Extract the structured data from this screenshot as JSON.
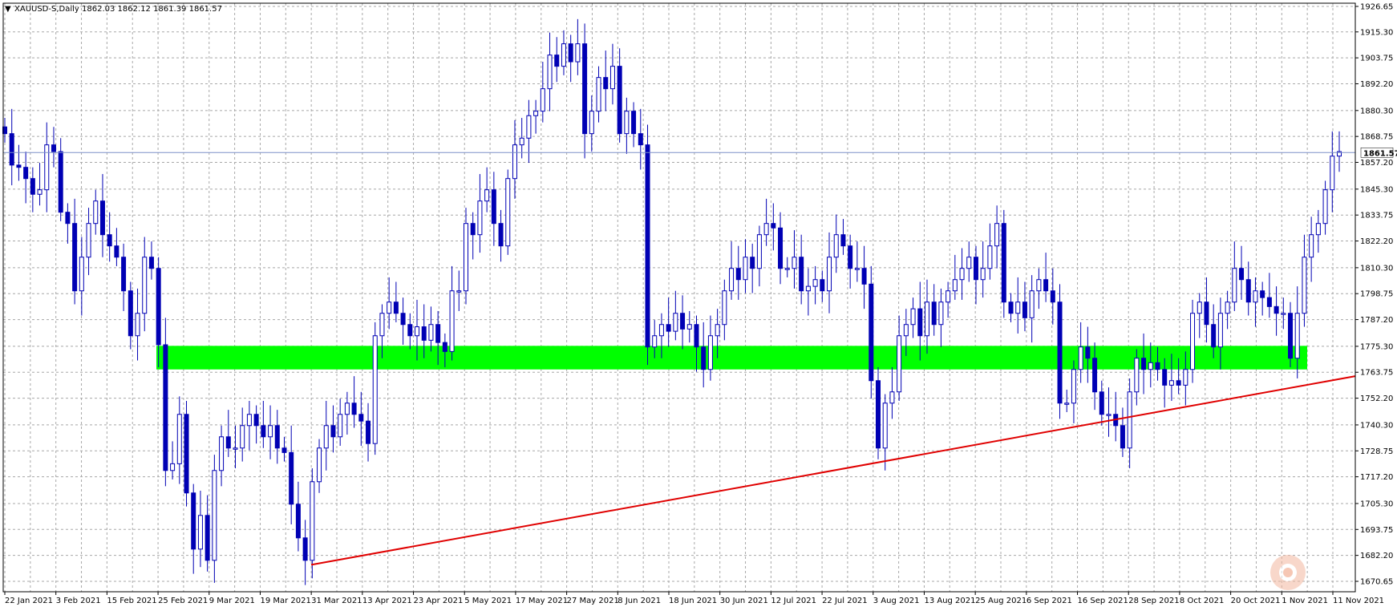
{
  "header": {
    "symbol": "XAUUSD-S,Daily",
    "ohlc": "1862.03 1862.12 1861.39 1861.57"
  },
  "colors": {
    "candle": "#0000B4",
    "grid": "#A8A8A8",
    "zone": "#00FF00",
    "trendline": "#E00000",
    "current_price_line": "#7C8FC8"
  },
  "chart_data": {
    "type": "candlestick",
    "symbol": "XAUUSD-S",
    "timeframe": "Daily",
    "ylim": [
      1666.5,
      1930.0
    ],
    "y_ticks": [
      "1926.65",
      "1915.30",
      "1903.75",
      "1892.20",
      "1880.30",
      "1868.75",
      "1857.20",
      "1845.30",
      "1833.75",
      "1822.20",
      "1810.30",
      "1798.75",
      "1787.20",
      "1775.30",
      "1763.75",
      "1752.20",
      "1740.30",
      "1728.75",
      "1717.20",
      "1705.30",
      "1693.75",
      "1682.20",
      "1670.65"
    ],
    "x_ticks": [
      "22 Jan 2021",
      "3 Feb 2021",
      "15 Feb 2021",
      "25 Feb 2021",
      "9 Mar 2021",
      "19 Mar 2021",
      "31 Mar 2021",
      "13 Apr 2021",
      "23 Apr 2021",
      "5 May 2021",
      "17 May 2021",
      "27 May 2021",
      "8 Jun 2021",
      "18 Jun 2021",
      "30 Jun 2021",
      "12 Jul 2021",
      "22 Jul 2021",
      "3 Aug 2021",
      "13 Aug 2021",
      "25 Aug 2021",
      "6 Sep 2021",
      "16 Sep 2021",
      "28 Sep 2021",
      "8 Oct 2021",
      "20 Oct 2021",
      "1 Nov 2021",
      "11 Nov 2021"
    ],
    "current_price": "1861.57",
    "support_zone": {
      "from": 1765.0,
      "to": 1775.5
    },
    "trendline": {
      "start": [
        "31 Mar 2021",
        1678.0
      ],
      "end": [
        "11 Nov 2021",
        1762.0
      ]
    },
    "closes": [
      1870,
      1856,
      1855,
      1850,
      1843,
      1845,
      1865,
      1862,
      1835,
      1830,
      1800,
      1815,
      1830,
      1840,
      1825,
      1820,
      1815,
      1800,
      1780,
      1790,
      1815,
      1810,
      1776,
      1720,
      1723,
      1745,
      1710,
      1685,
      1700,
      1680,
      1720,
      1735,
      1730,
      1730,
      1740,
      1745,
      1740,
      1735,
      1740,
      1730,
      1728,
      1705,
      1690,
      1680,
      1715,
      1730,
      1740,
      1735,
      1745,
      1750,
      1745,
      1742,
      1732,
      1780,
      1790,
      1795,
      1790,
      1785,
      1780,
      1784,
      1778,
      1785,
      1777,
      1773,
      1800,
      1800,
      1830,
      1825,
      1840,
      1845,
      1830,
      1820,
      1850,
      1865,
      1868,
      1878,
      1880,
      1890,
      1905,
      1900,
      1910,
      1902,
      1910,
      1870,
      1880,
      1895,
      1890,
      1900,
      1870,
      1880,
      1870,
      1865,
      1775,
      1780,
      1785,
      1782,
      1790,
      1783,
      1785,
      1775,
      1765,
      1780,
      1785,
      1800,
      1810,
      1805,
      1815,
      1810,
      1825,
      1830,
      1828,
      1810,
      1810,
      1815,
      1800,
      1802,
      1805,
      1800,
      1815,
      1825,
      1820,
      1810,
      1810,
      1803,
      1760,
      1730,
      1750,
      1755,
      1780,
      1785,
      1792,
      1780,
      1795,
      1785,
      1795,
      1800,
      1805,
      1810,
      1815,
      1805,
      1810,
      1820,
      1830,
      1795,
      1790,
      1795,
      1788,
      1800,
      1805,
      1800,
      1795,
      1750,
      1750,
      1765,
      1775,
      1770,
      1755,
      1745,
      1745,
      1740,
      1730,
      1755,
      1770,
      1765,
      1768,
      1765,
      1758,
      1760,
      1758,
      1765,
      1790,
      1795,
      1785,
      1775,
      1790,
      1795,
      1810,
      1805,
      1795,
      1800,
      1797,
      1793,
      1790,
      1790,
      1770,
      1790,
      1815,
      1825,
      1830,
      1845,
      1860,
      1862
    ]
  }
}
